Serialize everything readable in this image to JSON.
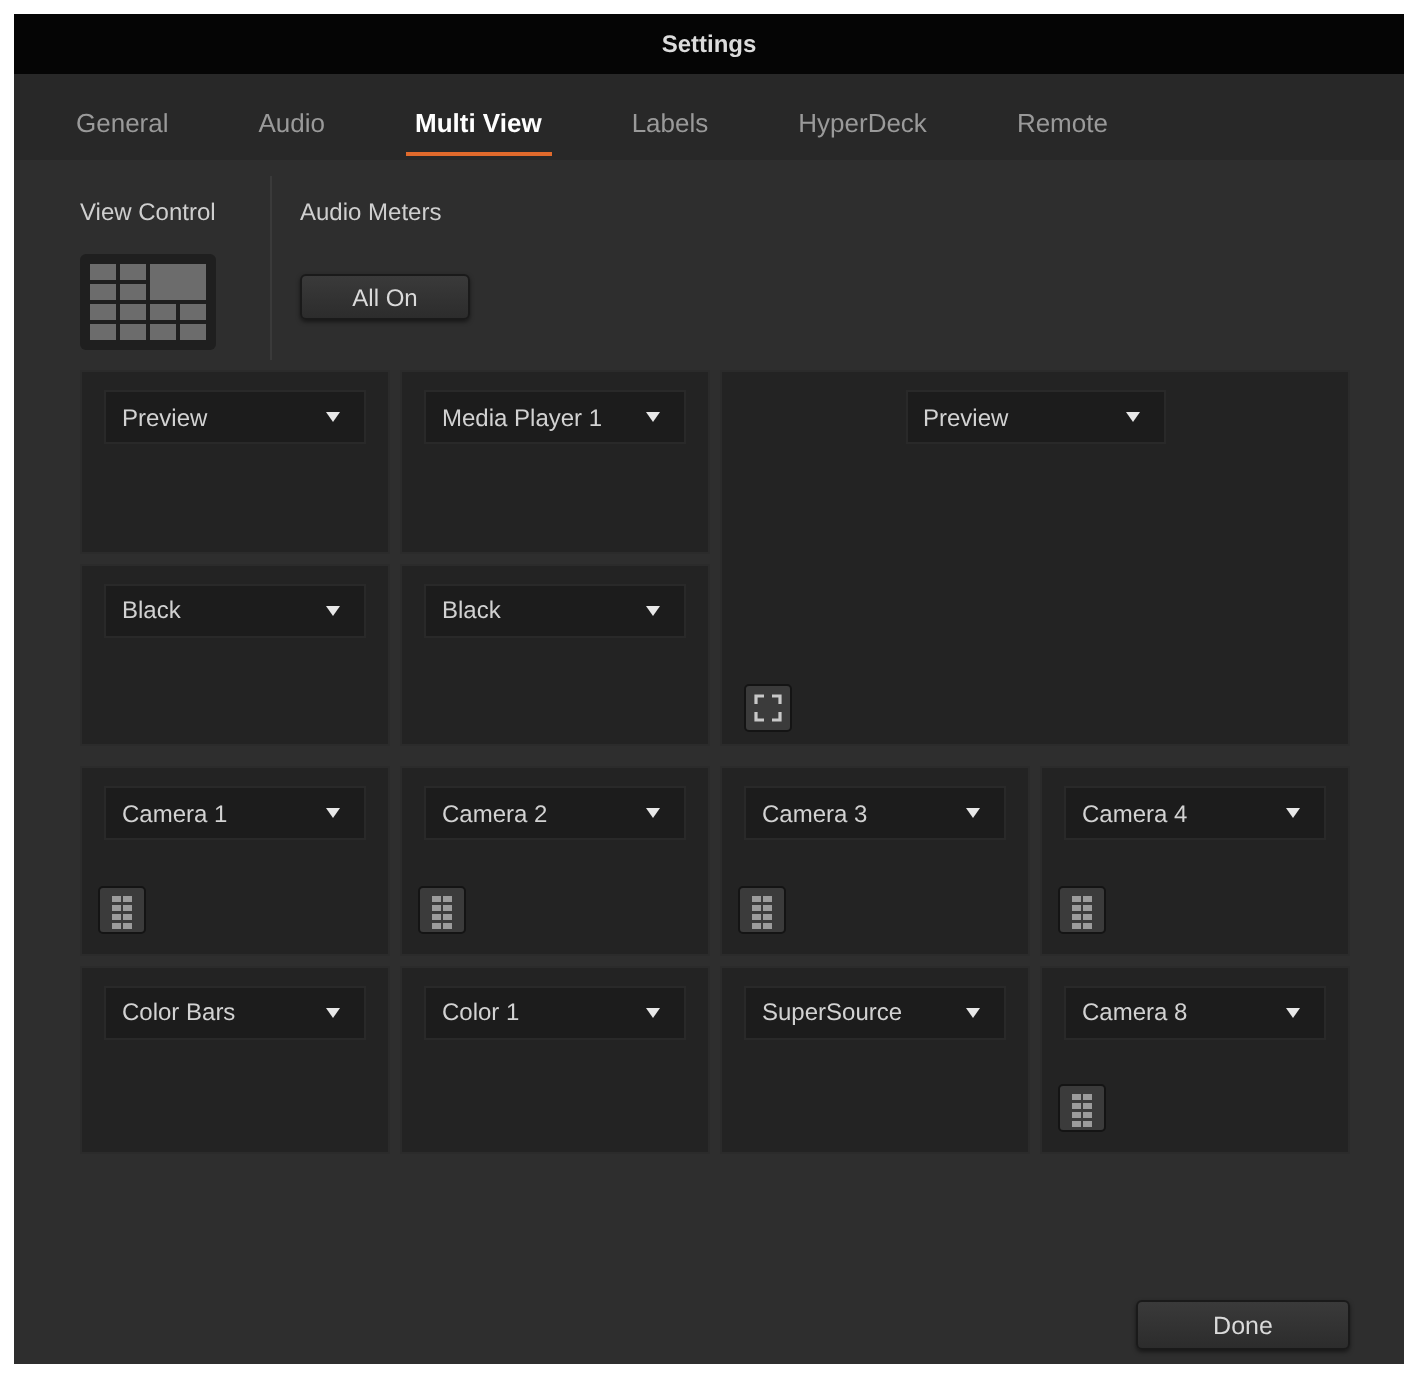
{
  "window": {
    "title": "Settings"
  },
  "tabs": [
    {
      "label": "General",
      "selected": false
    },
    {
      "label": "Audio",
      "selected": false
    },
    {
      "label": "Multi View",
      "selected": true
    },
    {
      "label": "Labels",
      "selected": false
    },
    {
      "label": "HyperDeck",
      "selected": false
    },
    {
      "label": "Remote",
      "selected": false
    }
  ],
  "view_control": {
    "label": "View Control"
  },
  "audio_meters": {
    "label": "Audio Meters",
    "button": "All On"
  },
  "multiview": {
    "quadrants": [
      {
        "kind": "split",
        "windows": [
          {
            "source": "Preview",
            "kind": "plain"
          },
          {
            "source": "Media Player 1",
            "kind": "plain"
          },
          {
            "source": "Black",
            "kind": "plain"
          },
          {
            "source": "Black",
            "kind": "plain"
          }
        ]
      },
      {
        "kind": "single",
        "windows": [
          {
            "source": "Preview",
            "kind": "safe_area"
          }
        ]
      },
      {
        "kind": "split",
        "windows": [
          {
            "source": "Camera 1",
            "kind": "meter"
          },
          {
            "source": "Camera 2",
            "kind": "meter"
          },
          {
            "source": "Color Bars",
            "kind": "plain"
          },
          {
            "source": "Color 1",
            "kind": "plain"
          }
        ]
      },
      {
        "kind": "split",
        "windows": [
          {
            "source": "Camera 3",
            "kind": "meter"
          },
          {
            "source": "Camera 4",
            "kind": "meter"
          },
          {
            "source": "SuperSource",
            "kind": "plain"
          },
          {
            "source": "Camera 8",
            "kind": "meter"
          }
        ]
      }
    ]
  },
  "done_button": {
    "label": "Done"
  }
}
